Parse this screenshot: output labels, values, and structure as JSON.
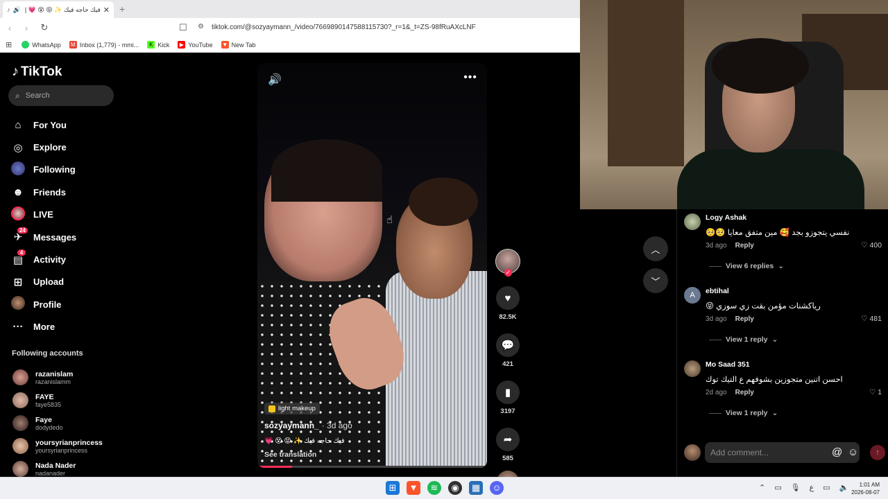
{
  "browser": {
    "tab_title": "فيك حاجه فيك ✨ 😝 😵 💗 |",
    "url": "tiktok.com/@sozyaymann_/video/7669890147588115730?_r=1&_t=ZS-98fRuAXcLNF",
    "bookmarks": [
      {
        "label": "WhatsApp",
        "color": "#25d366",
        "icon": "whatsapp-icon"
      },
      {
        "label": "Inbox (1,779) - mmi...",
        "color": "#ea4335",
        "icon": "gmail-icon"
      },
      {
        "label": "Kick",
        "color": "#53fc18",
        "icon": "kick-icon"
      },
      {
        "label": "YouTube",
        "color": "#ff0000",
        "icon": "youtube-icon"
      },
      {
        "label": "New Tab",
        "color": "#fb542b",
        "icon": "brave-icon"
      }
    ]
  },
  "tiktok": {
    "logo": "TikTok",
    "search_placeholder": "Search",
    "nav": [
      {
        "label": "For You",
        "icon": "home-icon",
        "glyph": "⌂"
      },
      {
        "label": "Explore",
        "icon": "compass-icon",
        "glyph": "◎"
      },
      {
        "label": "Following",
        "icon": "following-avatar",
        "glyph": ""
      },
      {
        "label": "Friends",
        "icon": "friends-icon",
        "glyph": "☻"
      },
      {
        "label": "LIVE",
        "icon": "live-icon",
        "glyph": ""
      },
      {
        "label": "Messages",
        "icon": "messages-icon",
        "glyph": "✈",
        "badge": "24"
      },
      {
        "label": "Activity",
        "icon": "activity-icon",
        "glyph": "▤",
        "badge": "4"
      },
      {
        "label": "Upload",
        "icon": "upload-icon",
        "glyph": "⊞"
      },
      {
        "label": "Profile",
        "icon": "profile-avatar",
        "glyph": ""
      },
      {
        "label": "More",
        "icon": "more-icon",
        "glyph": "···"
      }
    ],
    "following_heading": "Following accounts",
    "following_accounts": [
      {
        "name": "razanislam",
        "user": "razanislamm",
        "color": "#6b3a3a"
      },
      {
        "name": "FAYE",
        "user": "faye5835",
        "color": "#8a6a5a"
      },
      {
        "name": "Faye",
        "user": "dodydedo",
        "color": "#4a3a3a"
      },
      {
        "name": "yoursyrianprincess",
        "user": "yoursyrianprincess",
        "color": "#b08a70"
      },
      {
        "name": "Nada Nader",
        "user": "nadanader",
        "color": "#7a5a50"
      }
    ]
  },
  "video": {
    "tag": "light makeup",
    "author": "sozyaymann_",
    "ago": "· 3d ago",
    "caption": "فيك حاجه فيك ✨ 😝 😵 💗",
    "see_translation": "See translation",
    "progress": 0.15,
    "likes": "82.5K",
    "comments": "421",
    "saves": "3197",
    "shares": "585"
  },
  "comments": [
    {
      "name": "Logy Ashak",
      "text": "نفسي يتجوزو بجد 🥰 مين متفق معايا 🥺🥺",
      "ago": "3d ago",
      "reply": "Reply",
      "likes": "400",
      "replies": "View 6 replies",
      "av": "L",
      "color": "#8aa07a"
    },
    {
      "name": "ebtihal",
      "text": "رياكشنات مؤمن بقت زي سوزي 😝",
      "ago": "3d ago",
      "reply": "Reply",
      "likes": "481",
      "replies": "View 1 reply",
      "av": "A",
      "color": "#6a7a90"
    },
    {
      "name": "Mo Saad 351",
      "text": "احسن اتنين متجوزين بشوفهم ع التيك توك",
      "ago": "2d ago",
      "reply": "Reply",
      "likes": "1",
      "replies": "View 1 reply",
      "av": "",
      "color": "#8a7560"
    }
  ],
  "comment_input": {
    "placeholder": "Add comment..."
  },
  "taskbar": {
    "time": "1:01 AM",
    "date": "2026-08-07",
    "lang": "ع"
  }
}
